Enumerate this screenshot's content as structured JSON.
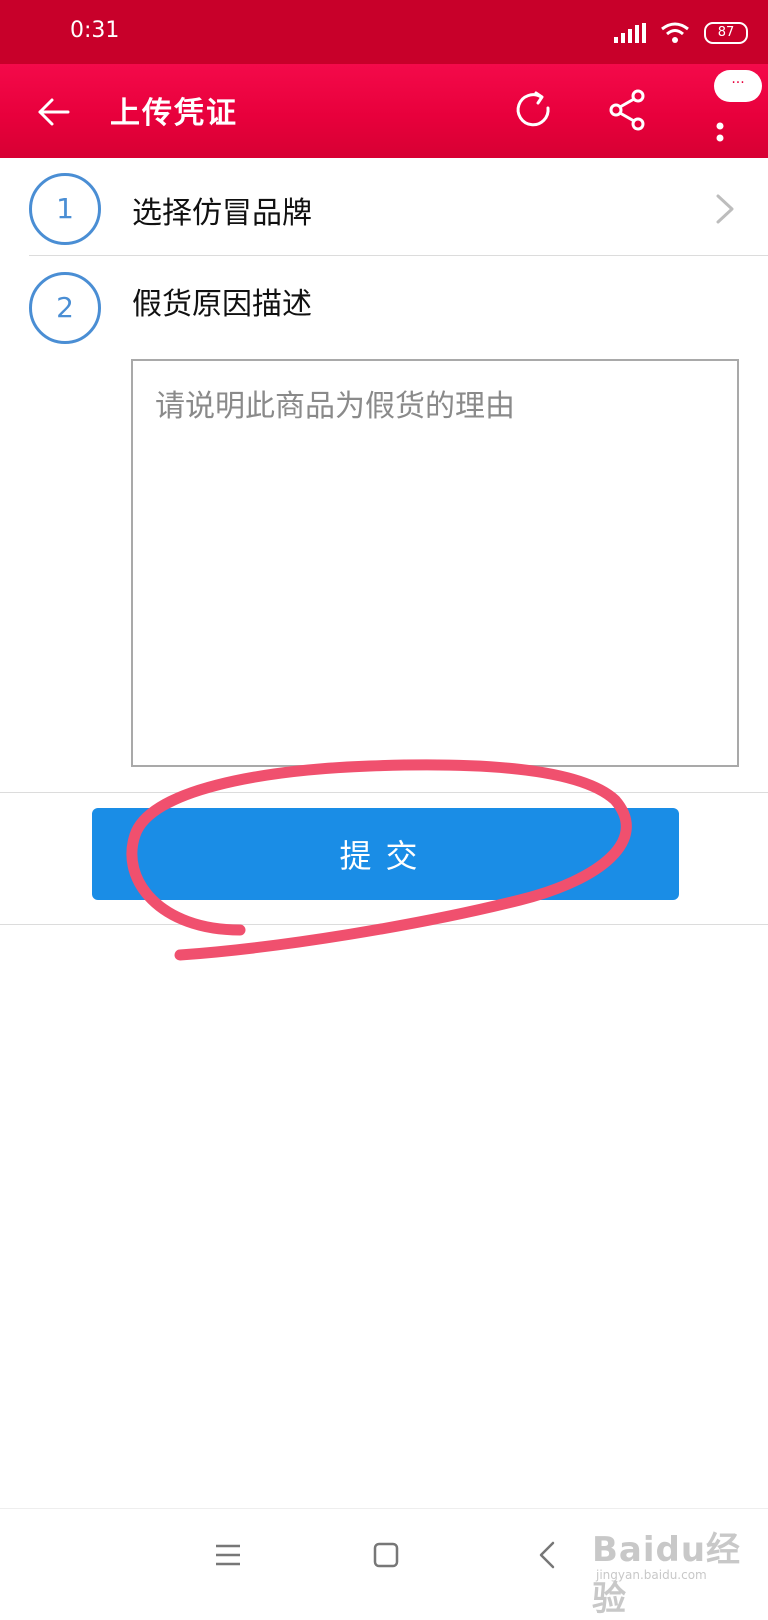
{
  "status_bar": {
    "time": "0:31",
    "battery": "87"
  },
  "header": {
    "title": "上传凭证",
    "bubble": "···"
  },
  "steps": [
    {
      "number": "1",
      "label": "选择仿冒品牌"
    },
    {
      "number": "2",
      "label": "假货原因描述"
    }
  ],
  "description": {
    "placeholder": "请说明此商品为假货的理由",
    "value": ""
  },
  "submit": {
    "label": "提交"
  },
  "annotation_color": "#f0506e",
  "accent_color": "#1a8de6",
  "header_color": "#e8003c",
  "watermark": {
    "brand": "Baidu经验",
    "url": "jingyan.baidu.com"
  }
}
